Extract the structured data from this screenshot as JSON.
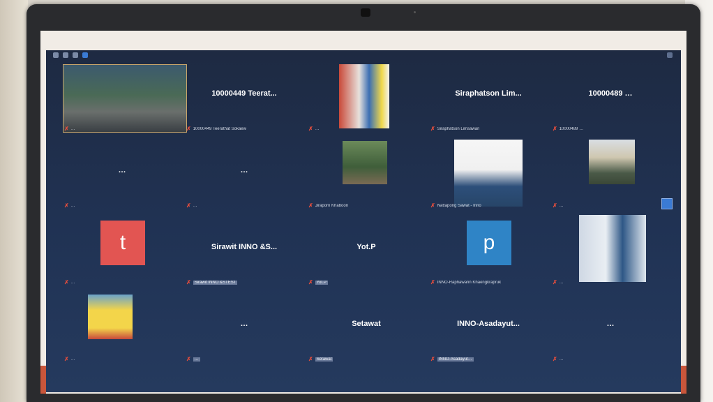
{
  "screen": {
    "tiles": [
      {
        "id": "t1",
        "big": "",
        "footer": "…",
        "kind": "video"
      },
      {
        "id": "t2",
        "big": "10000449 Teerat...",
        "footer": "10000449 Teerathat Sokaew",
        "kind": "name"
      },
      {
        "id": "t3",
        "big": "",
        "footer": "…",
        "kind": "photo"
      },
      {
        "id": "t4",
        "big": "Siraphatson Lim...",
        "footer": "Siraphatson Limsawan",
        "kind": "name"
      },
      {
        "id": "t5",
        "big": "10000489 …",
        "footer": "10000489 …",
        "kind": "name"
      },
      {
        "id": "t6",
        "big": "…",
        "footer": "…",
        "kind": "name"
      },
      {
        "id": "t7",
        "big": "…",
        "footer": "…",
        "kind": "name"
      },
      {
        "id": "t8",
        "big": "",
        "footer": "Jiraporn Khaboon",
        "kind": "photo"
      },
      {
        "id": "t9",
        "big": "",
        "footer": "Nattapong Sawat - Inno",
        "kind": "photo"
      },
      {
        "id": "t10",
        "big": "",
        "footer": "…",
        "kind": "photo"
      },
      {
        "id": "t11",
        "big": "",
        "footer": "…",
        "kind": "letter",
        "letter": "t",
        "color": "#e25552"
      },
      {
        "id": "t12",
        "big": "Sirawit INNO &S...",
        "footer": "Sirawit INNO &STEST",
        "kind": "name",
        "boxed": true
      },
      {
        "id": "t13",
        "big": "Yot.P",
        "footer": "Yot.P",
        "kind": "name",
        "boxed": true
      },
      {
        "id": "t14",
        "big": "",
        "footer": "INNO-Raphawarin Khaengkrapruk",
        "kind": "letter",
        "letter": "p",
        "color": "#2f84c6"
      },
      {
        "id": "t15",
        "big": "",
        "footer": "…",
        "kind": "photo"
      },
      {
        "id": "t16",
        "big": "",
        "footer": "…",
        "kind": "cartoon"
      },
      {
        "id": "t17",
        "big": "…",
        "footer": "…",
        "kind": "name",
        "boxed": true
      },
      {
        "id": "t18",
        "big": "Setawat",
        "footer": "Setawat",
        "kind": "name",
        "boxed": true
      },
      {
        "id": "t19",
        "big": "INNO-Asadayut...",
        "footer": "INNO-Asadayut…",
        "kind": "name",
        "boxed": true
      },
      {
        "id": "t20",
        "big": "…",
        "footer": "…",
        "kind": "name"
      }
    ]
  },
  "colors": {
    "mic_muted": "#e34d3d",
    "accent": "#c9563b"
  },
  "icons": [
    "webcam-icon",
    "mic-muted-icon",
    "view-toggle-icon"
  ]
}
